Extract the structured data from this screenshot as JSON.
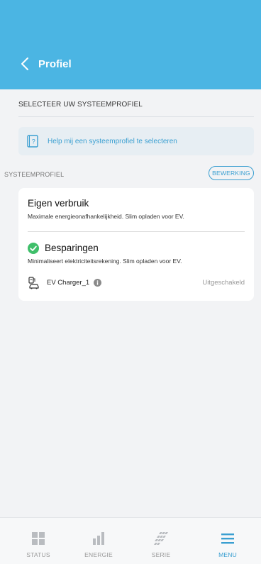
{
  "header": {
    "title": "Profiel",
    "back_icon": "chevron-left-icon",
    "color": "#4bb5e3"
  },
  "select_heading": "SELECTEER UW SYSTEEMPROFIEL",
  "help": {
    "text": "Help mij een systeemprofiel te selecteren",
    "icon": "question-book-icon"
  },
  "system_profile": {
    "label": "SYSTEEMPROFIEL",
    "edit_label": "BEWERKING",
    "profiles": [
      {
        "title": "Eigen verbruik",
        "description": "Maximale energieonafhankelijkheid. Slim opladen voor EV.",
        "selected": false
      },
      {
        "title": "Besparingen",
        "description": "Minimaliseert elektriciteitsrekening. Slim opladen voor EV.",
        "selected": true
      }
    ],
    "device": {
      "name": "EV Charger_1",
      "status": "Uitgeschakeld",
      "icon": "ev-charger-icon"
    }
  },
  "nav": {
    "items": [
      {
        "label": "STATUS",
        "icon": "grid-icon",
        "active": false
      },
      {
        "label": "ENERGIE",
        "icon": "bar-chart-icon",
        "active": false
      },
      {
        "label": "SERIE",
        "icon": "solar-panel-icon",
        "active": false
      },
      {
        "label": "MENU",
        "icon": "hamburger-menu-icon",
        "active": true
      }
    ]
  },
  "colors": {
    "accent": "#3a9fd1",
    "success": "#3fbf6a",
    "inactive": "#b9bcc0"
  }
}
